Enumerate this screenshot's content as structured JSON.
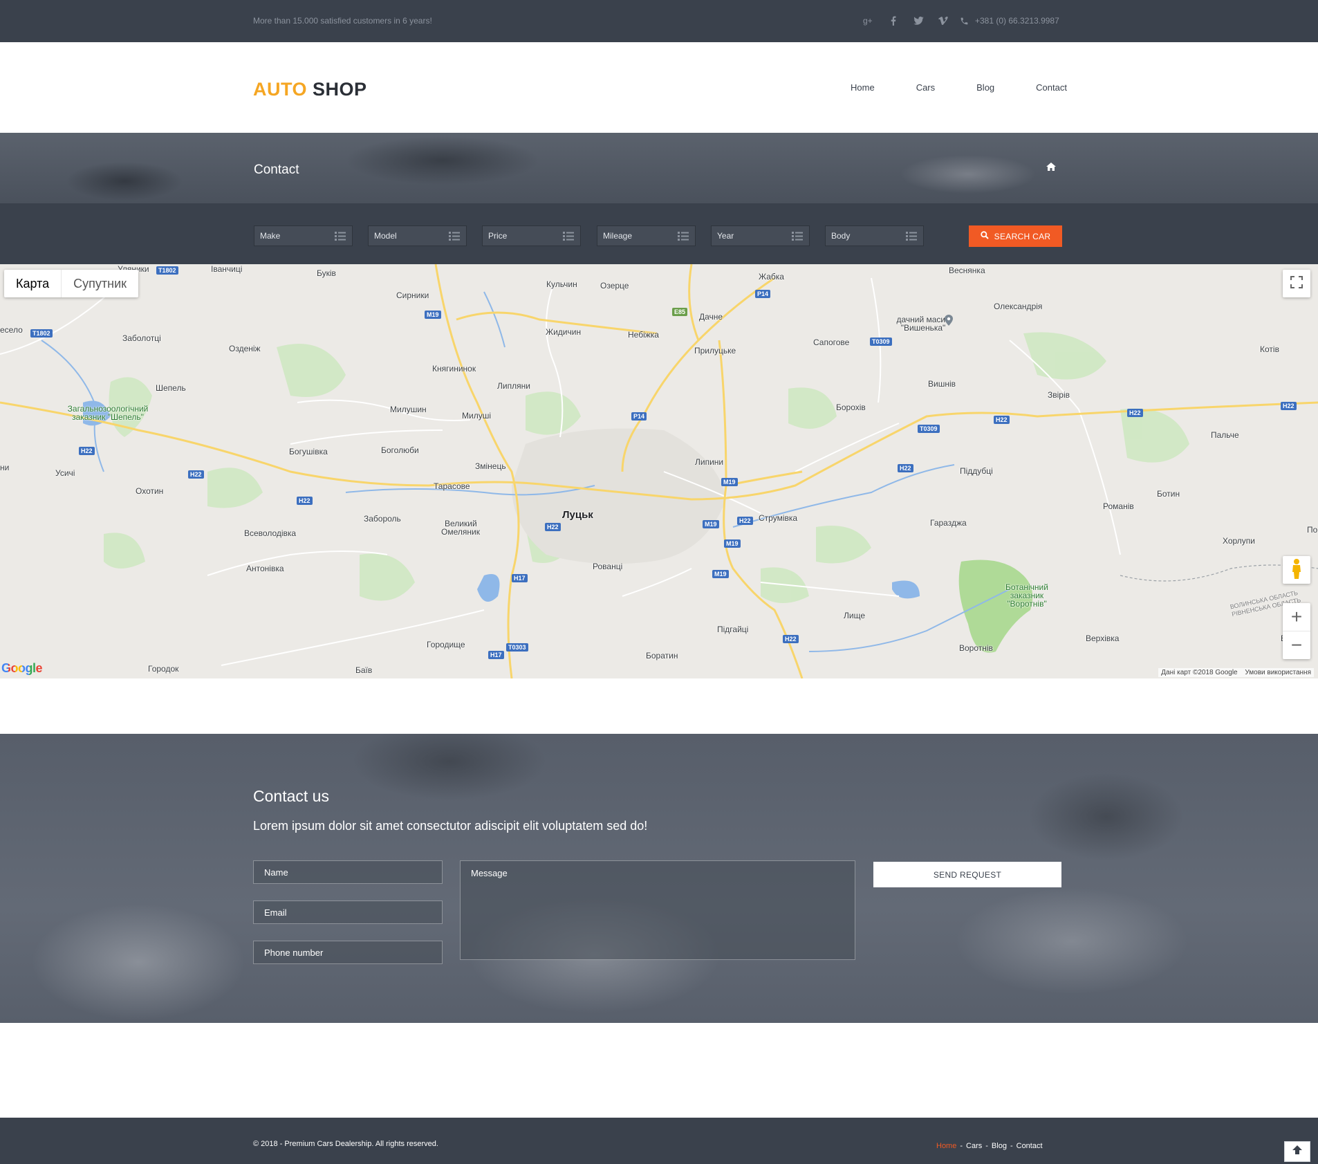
{
  "topbar": {
    "tagline": "More than 15.000 satisfied customers in 6 years!",
    "social": [
      "google-plus-icon",
      "facebook-icon",
      "twitter-icon",
      "vimeo-icon"
    ],
    "phone": "+381 (0) 66.3213.9987"
  },
  "brand": {
    "part1": "AUTO",
    "part2": "SHOP",
    "part1_color": "#f5a623",
    "part2_color": "#2b2f36"
  },
  "nav": [
    {
      "label": "Home",
      "active": false
    },
    {
      "label": "Cars",
      "active": false
    },
    {
      "label": "Blog",
      "active": false
    },
    {
      "label": "Contact",
      "active": true
    }
  ],
  "page_title": "Contact",
  "search": {
    "filters": [
      "Make",
      "Model",
      "Price",
      "Mileage",
      "Year",
      "Body"
    ],
    "button": "SEARCH CAR"
  },
  "map": {
    "type_buttons": [
      "Карта",
      "Супутник"
    ],
    "active_type": "Карта",
    "zoom_in": "+",
    "zoom_out": "−",
    "logo": "Google",
    "credit": "Дані карт ©2018 Google",
    "terms": "Умови використання",
    "labels": {
      "lutsk": "Луцьк",
      "ozertse": "Озерце",
      "zhabka": "Жабка",
      "vesnianka": "Веснянка",
      "kulchyn": "Кульчин",
      "bukiv": "Буків",
      "syrnyky": "Сирники",
      "ivanchytsi": "Іванчиці",
      "zabolottsi": "Заболотці",
      "ozdenizh": "Озденіж",
      "shepel": "Шепель",
      "reserve_shepel": "Загальнозоологічний заказник \"Шепель\"",
      "kniahynynok": "Княгининок",
      "lypliany": "Липляни",
      "zhydychyn": "Жидичин",
      "nebizhka": "Небіжка",
      "dachne": "Дачне",
      "prylutske": "Прилуцьке",
      "sapohove": "Сапогове",
      "vyshenka": "дачний масив \"Вишенька\"",
      "oleksandriia": "Олександрія",
      "kotiv": "Котів",
      "vyshniv": "Вишнів",
      "zviriv": "Звірів",
      "borokhiv": "Борохів",
      "palche": "Пальче",
      "milushyn": "Милушин",
      "milushi": "Милуші",
      "boholiuby": "Боголюби",
      "bohushivka": "Богушівка",
      "usychi": "Усичі",
      "okhotyn": "Охотин",
      "zminets": "Змінець",
      "tarasove": "Тарасове",
      "lypyny": "Липини",
      "piddubtsi": "Піддубці",
      "zaborol": "Забороль",
      "velykyi": "Великий",
      "omelianyk": "Омеляник",
      "strumivka": "Струмівка",
      "haraizha": "Гаразджа",
      "romaniv": "Романів",
      "botyn": "Ботин",
      "khorlupy": "Хорлупи",
      "vsevolodivka": "Всеволодівка",
      "antonivka": "Антонівка",
      "rovantsi": "Рованці",
      "botanical": "Ботанічний заказник \"Воротнів\"",
      "lyshche": "Лище",
      "pidhaitsi": "Підгайці",
      "verkhivka": "Верхівка",
      "vorotniv": "Воротнів",
      "horodyshche": "Городище",
      "boratyn": "Боратин",
      "horodok": "Городок",
      "baiv": "Баїв",
      "oblast": "ВОЛИНСЬКА ОБЛАСТЬ РІВНЕНСЬКА ОБЛАСТЬ",
      "vesele": "есело",
      "uliany": "Уляники",
      "ny": "ни",
      "po": "По",
      "ye": "Е"
    },
    "shields": [
      "T1802",
      "T1802",
      "M19",
      "P14",
      "E85",
      "T0309",
      "T0309",
      "H22",
      "H22",
      "H22",
      "H22",
      "H22",
      "H22",
      "P14",
      "M19",
      "H22",
      "H22",
      "M19",
      "M19",
      "H17",
      "H17",
      "T0303",
      "M19",
      "H22",
      "H22"
    ]
  },
  "contact": {
    "title": "Contact us",
    "lead": "Lorem ipsum dolor sit amet consectutor adiscipit elit voluptatem sed do!",
    "name_placeholder": "Name",
    "email_placeholder": "Email",
    "phone_placeholder": "Phone number",
    "message_placeholder": "Message",
    "button": "SEND REQUEST"
  },
  "footer": {
    "copyright": "© 2018 - Premium Cars Dealership. All rights reserved.",
    "links": [
      {
        "label": "Home",
        "active": true
      },
      {
        "label": "Cars",
        "active": false
      },
      {
        "label": "Blog",
        "active": false
      },
      {
        "label": "Contact",
        "active": false
      }
    ],
    "separator": "-"
  },
  "colors": {
    "accent": "#f15a24",
    "dark": "#3a414c"
  }
}
